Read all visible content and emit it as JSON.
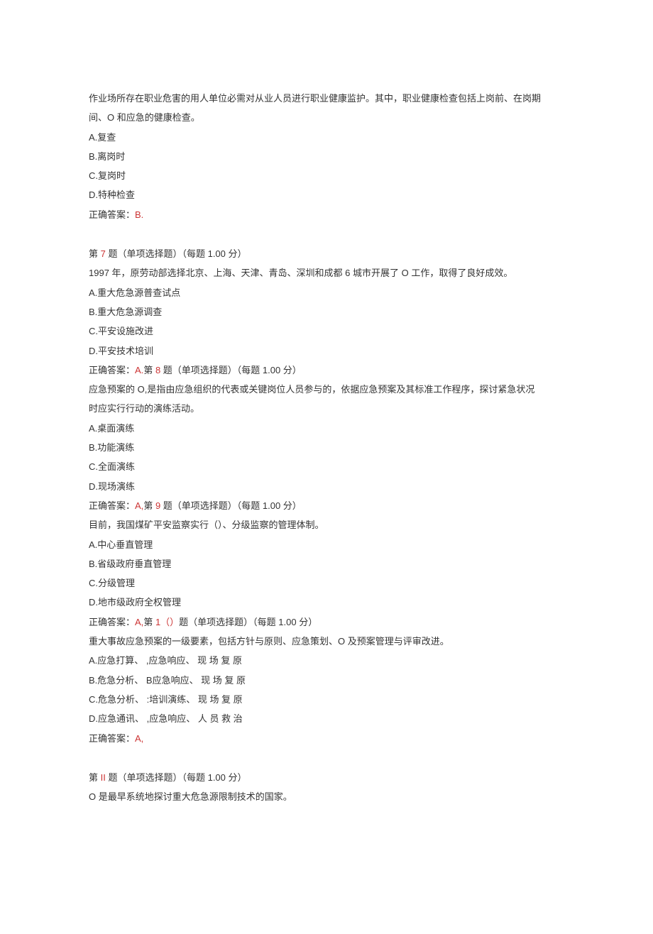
{
  "q6": {
    "stem_l1": "作业场所存在职业危害的用人单位必需对从业人员进行职业健康监护。其中，职业健康检查包括上岗前、在岗期",
    "stem_l2": "间、O 和应急的健康检查。",
    "optA": "A.复查",
    "optB": "B.离岗时",
    "optC": "C.复岗时",
    "optD": "D.特种检查",
    "ans_label": "正确答案：",
    "ans_val": "B."
  },
  "q7": {
    "header_pre": "第 ",
    "header_num": "7",
    "header_post": " 题（单项选择题）（每题 1.00 分）",
    "stem": "1997 年，原劳动部选择北京、上海、天津、青岛、深圳和成都 6 城市开展了 O 工作，取得了良好成效。",
    "optA": "A.重大危急源普查试点",
    "optB": "B.重大危急源调查",
    "optC": "C.平安设施改进",
    "optD": "D.平安技术培训",
    "ans_label": "正确答案：",
    "ans_val": "A."
  },
  "q8": {
    "header_pre": "第 ",
    "header_num": "8",
    "header_post": " 题（单项选择题）（每题 1.00 分）",
    "stem_l1": "应急预案的 O,是指由应急组织的代表或关键岗位人员参与的，依据应急预案及其标准工作程序，探讨紧急状况",
    "stem_l2": "时应实行行动的演练活动。",
    "optA": "A.桌面演练",
    "optB": "B.功能演练",
    "optC": "C.全面演练",
    "optD": "D.现场演练",
    "ans_label": "正确答案：",
    "ans_val": "A,"
  },
  "q9": {
    "header_pre": "第 ",
    "header_num": "9",
    "header_post": " 题（单项选择题）（每题 1.00 分）",
    "stem": "目前，我国煤矿平安监察实行（）、分级监察的管理体制。",
    "optA": "A.中心垂直管理",
    "optB": "B.省级政府垂直管理",
    "optC": "C.分级管理",
    "optD": "D.地市级政府全权管理",
    "ans_label": "正确答案：",
    "ans_val": "A,"
  },
  "q10": {
    "header_pre": "第 ",
    "header_num": "1（）",
    "header_post": "题（单项选择题）（每题 1.00 分）",
    "stem": "重大事故应急预案的一级要素，包括方针与原则、应急策划、O 及预案管理与评审改进。",
    "optA": "A.应急打算、 ,应急响应、 现 场 复 原",
    "optB": "B.危急分析、 B应急响应、 现 场 复 原",
    "optC": "C.危急分析、 :培训演练、 现 场 复 原",
    "optD": "D.应急通讯、 ,应急响应、 人 员 救 治",
    "ans_label": "正确答案：",
    "ans_val": "A,"
  },
  "q11": {
    "header_pre": "第 ",
    "header_num": "II",
    "header_post": " 题（单项选择题）（每题 1.00 分）",
    "stem": "O 是最早系统地探讨重大危急源限制技术的国家。"
  }
}
